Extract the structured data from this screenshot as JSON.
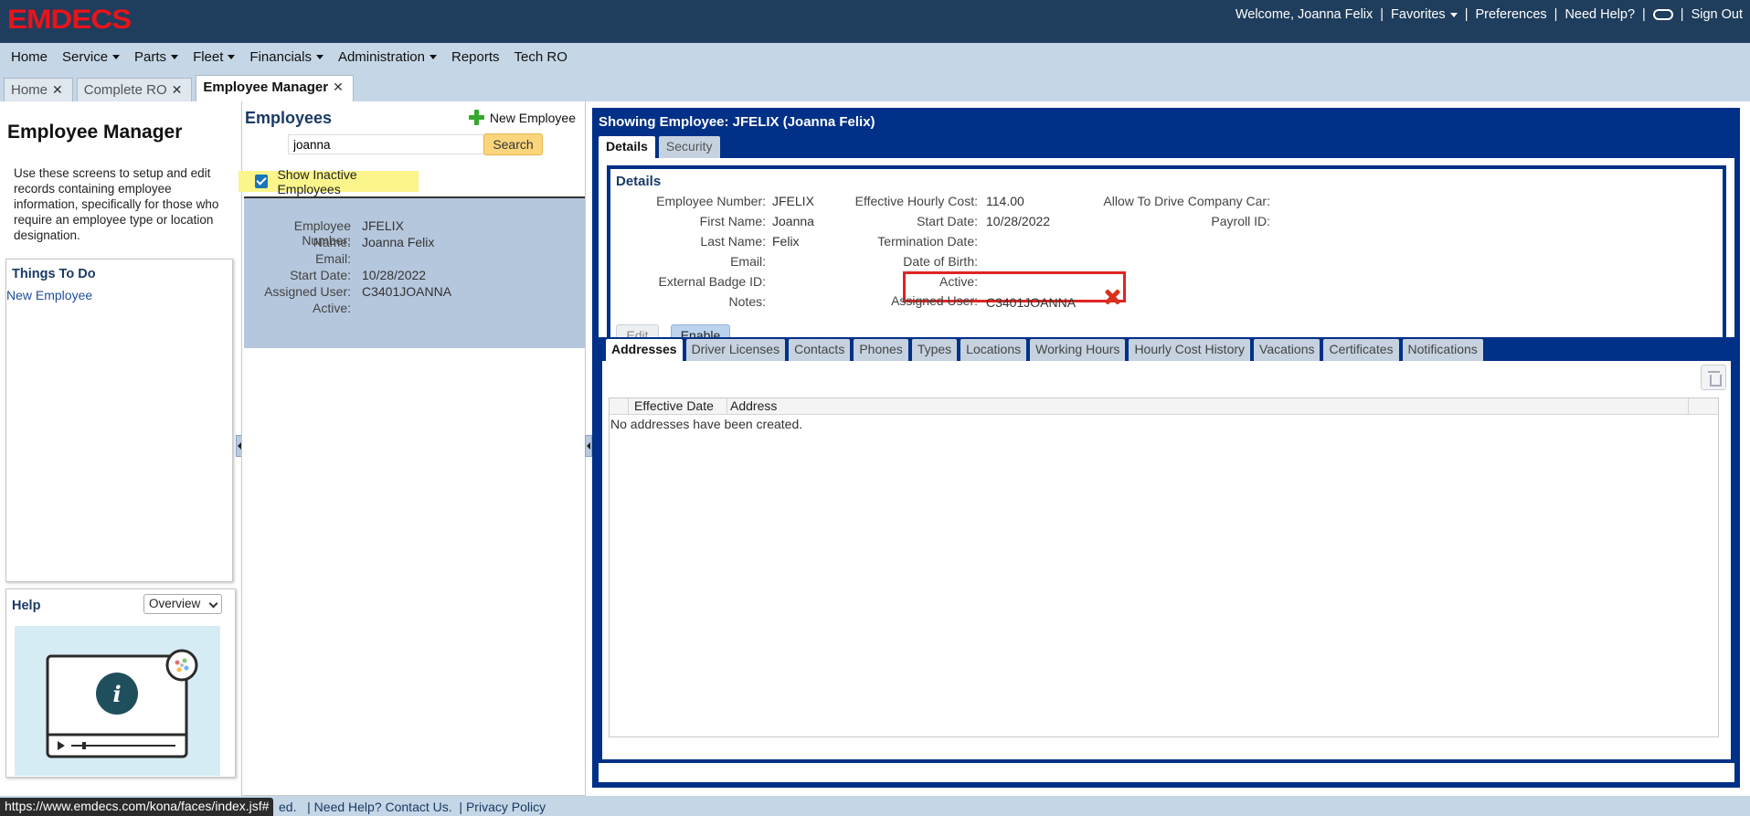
{
  "brand": {
    "logo": "EMDECS",
    "logo_color": "#e8141b"
  },
  "userbar": {
    "welcome": "Welcome, Joanna Felix",
    "favorites": "Favorites",
    "preferences": "Preferences",
    "need_help": "Need Help?",
    "sign_out": "Sign Out"
  },
  "menu": [
    "Home",
    "Service",
    "Parts",
    "Fleet",
    "Financials",
    "Administration",
    "Reports",
    "Tech RO"
  ],
  "page_tabs": [
    {
      "label": "Home"
    },
    {
      "label": "Complete RO"
    },
    {
      "label": "Employee Manager"
    }
  ],
  "left": {
    "title": "Employee Manager",
    "description": "Use these screens to setup and edit records containing employee information, specifically for those who require an employee type or location designation.",
    "todo_title": "Things To Do",
    "todo_link": "New Employee",
    "help_title": "Help",
    "help_select": "Overview"
  },
  "employees": {
    "title": "Employees",
    "new_button": "New Employee",
    "search_value": "joanna",
    "search_button": "Search",
    "show_inactive_label": "Show Inactive Employees",
    "show_inactive_checked": true,
    "card": {
      "employee_number_label": "Employee Number:",
      "employee_number": "JFELIX",
      "name_label": "Name:",
      "name": "Joanna Felix",
      "email_label": "Email:",
      "email": "",
      "start_date_label": "Start Date:",
      "start_date": "10/28/2022",
      "assigned_user_label": "Assigned User:",
      "assigned_user": "C3401JOANNA",
      "active_label": "Active:",
      "active": ""
    }
  },
  "detail": {
    "title": "Showing Employee: JFELIX (Joanna Felix)",
    "tabs": [
      "Details",
      "Security"
    ],
    "section_title": "Details",
    "fields": {
      "employee_number_label": "Employee Number:",
      "employee_number": "JFELIX",
      "first_name_label": "First Name:",
      "first_name": "Joanna",
      "last_name_label": "Last Name:",
      "last_name": "Felix",
      "email_label": "Email:",
      "badge_label": "External Badge ID:",
      "notes_label": "Notes:",
      "hourly_cost_label": "Effective Hourly Cost:",
      "hourly_cost": "114.00",
      "start_date_label": "Start Date:",
      "start_date": "10/28/2022",
      "termination_label": "Termination Date:",
      "dob_label": "Date of Birth:",
      "active_label": "Active:",
      "assigned_user_label": "Assigned User:",
      "assigned_user": "C3401JOANNA",
      "company_car_label": "Allow To Drive Company Car:",
      "payroll_label": "Payroll ID:"
    },
    "edit_button": "Edit",
    "enable_button": "Enable",
    "subtabs": [
      "Addresses",
      "Driver Licenses",
      "Contacts",
      "Phones",
      "Types",
      "Locations",
      "Working Hours",
      "Hourly Cost History",
      "Vacations",
      "Certificates",
      "Notifications"
    ],
    "addresses": {
      "columns": [
        "Effective Date",
        "Address"
      ],
      "empty_message": "No addresses have been created."
    }
  },
  "footer": {
    "partial": "ed.",
    "need_help": "Need Help? Contact Us.",
    "privacy": "Privacy Policy"
  },
  "status_url": "https://www.emdecs.com/kona/faces/index.jsf#"
}
